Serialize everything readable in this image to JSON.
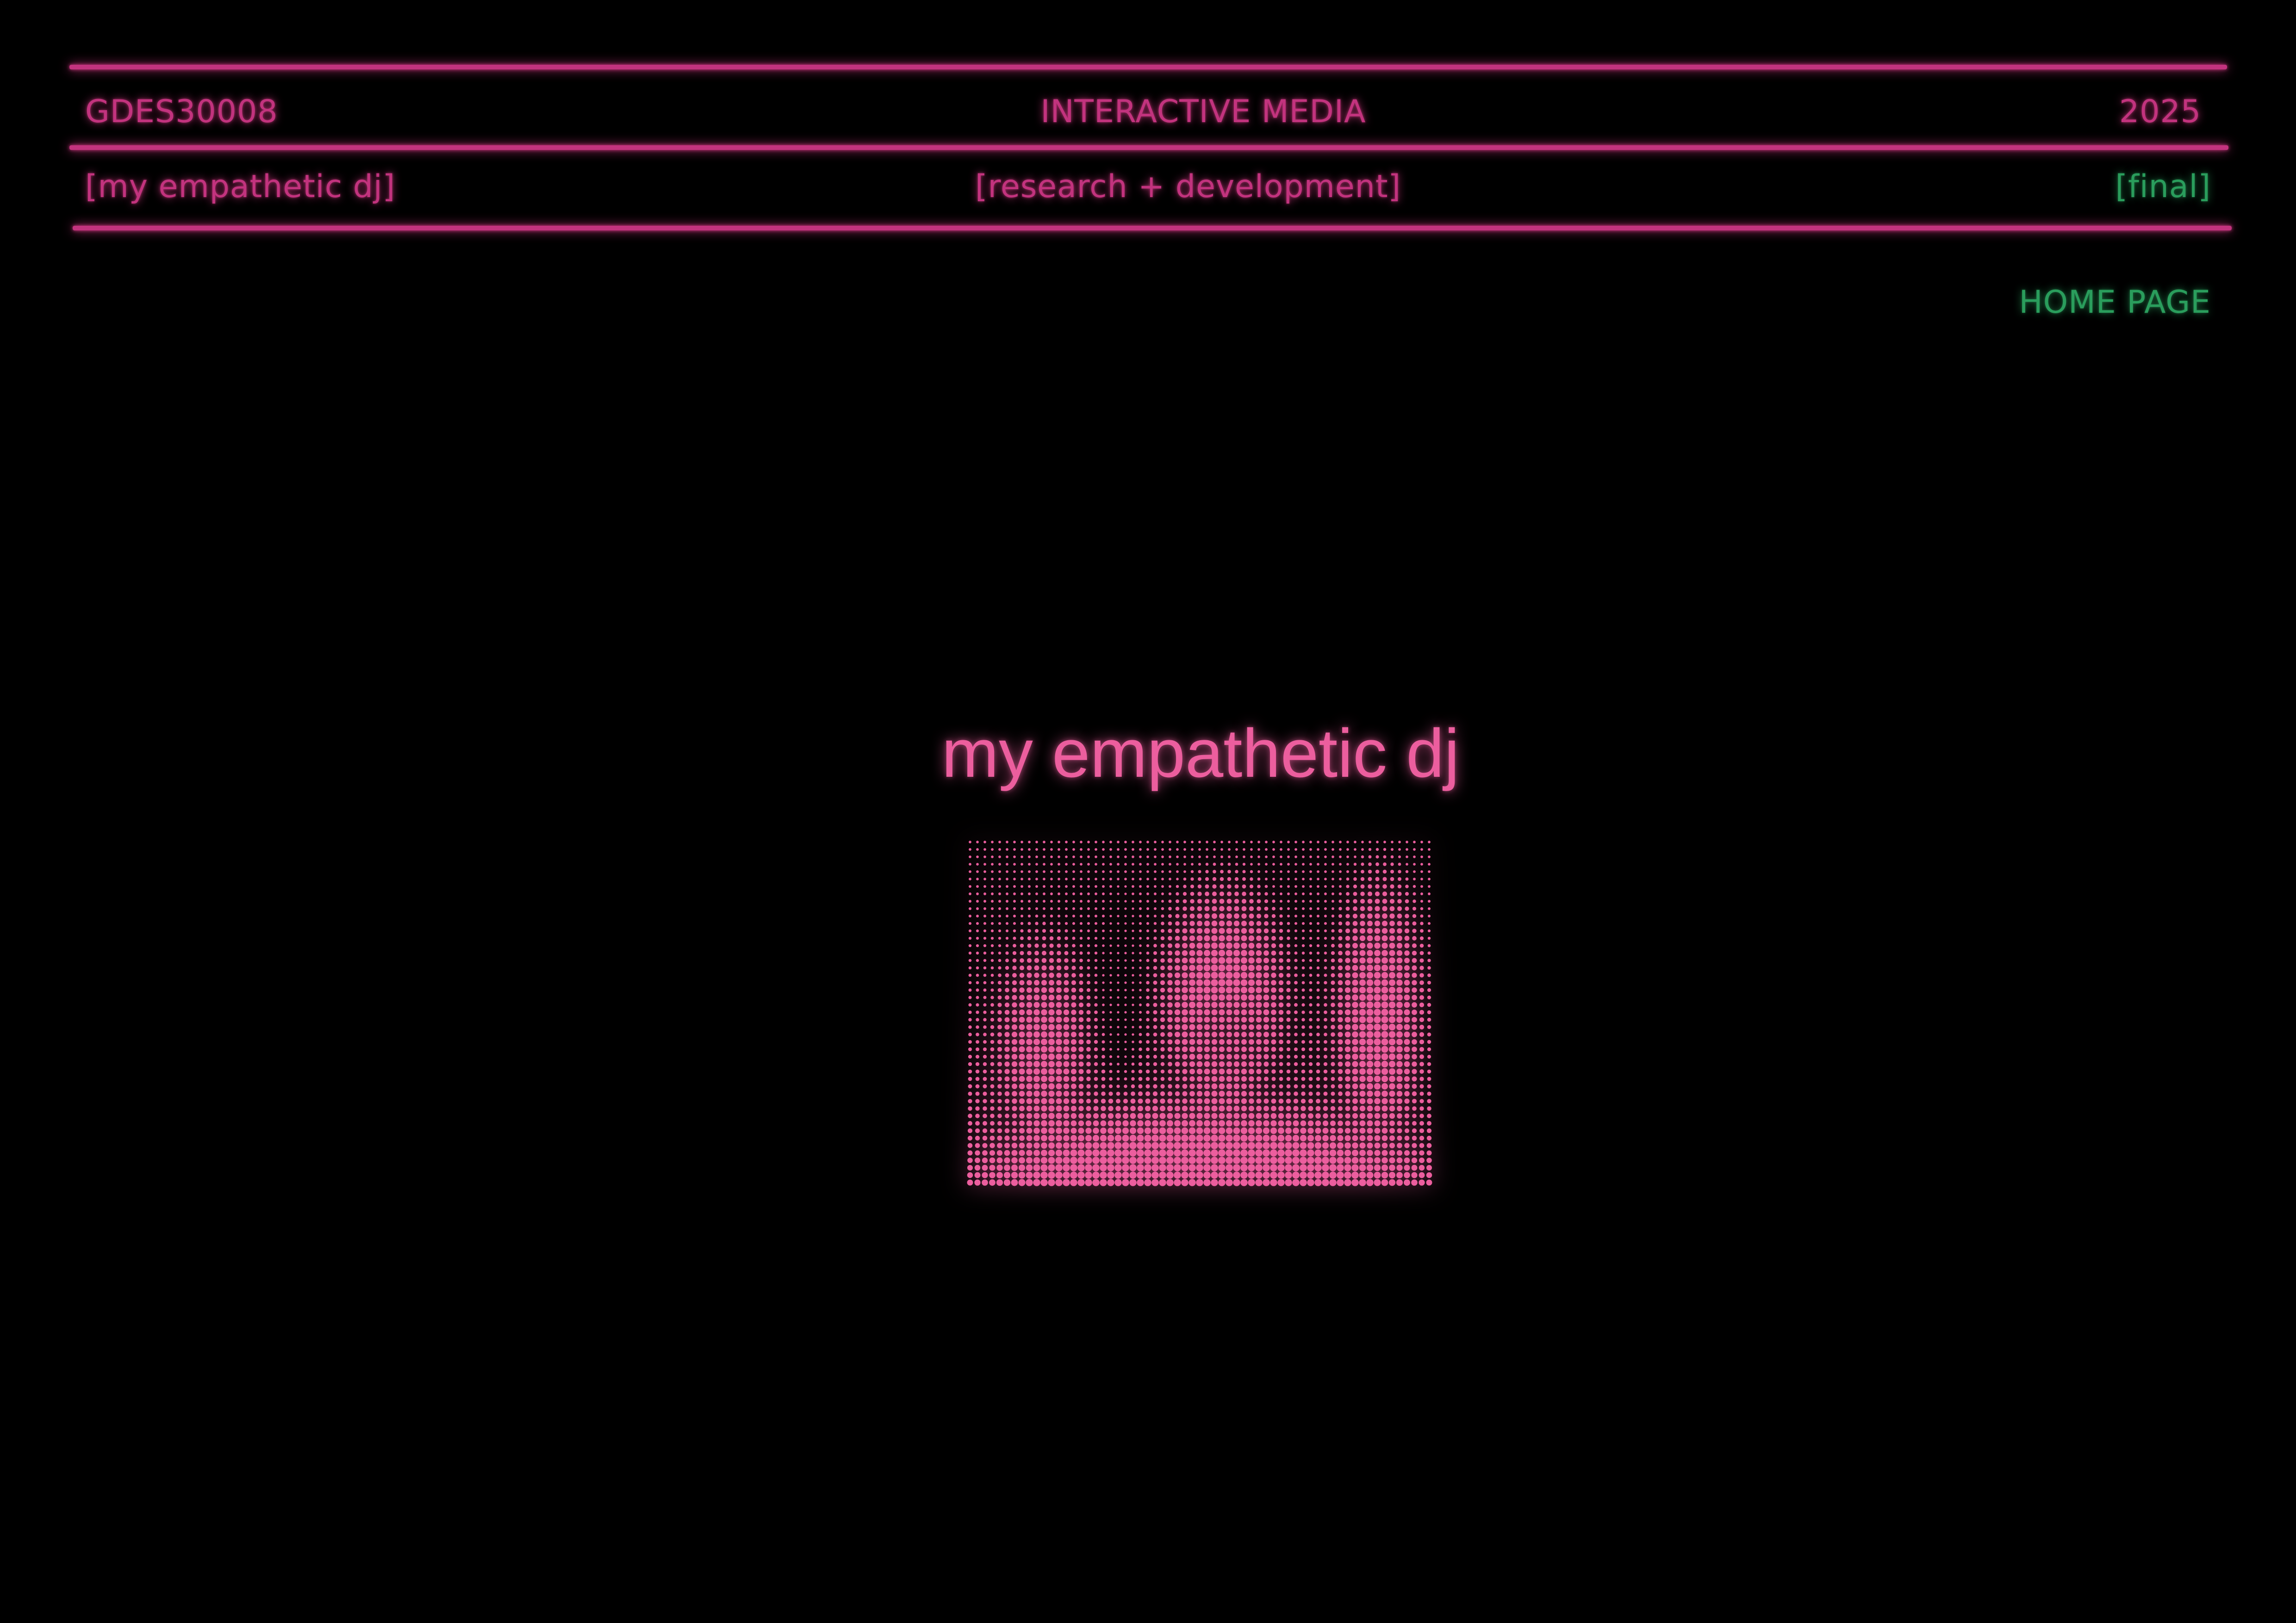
{
  "header": {
    "course_code": "GDES30008",
    "course_name": "INTERACTIVE MEDIA",
    "year": "2025",
    "project_name": "[my empathetic dj]",
    "stage": "[research + development]",
    "status": "[final]"
  },
  "nav": {
    "home_label": "HOME PAGE"
  },
  "hero": {
    "title": "my empathetic dj",
    "image_description_icon": "halftone-portrait-image"
  },
  "colors": {
    "background": "#000000",
    "accent_pink": "#c2337e",
    "hero_pink": "#ec5e9e",
    "accent_green": "#2a9d5c"
  }
}
